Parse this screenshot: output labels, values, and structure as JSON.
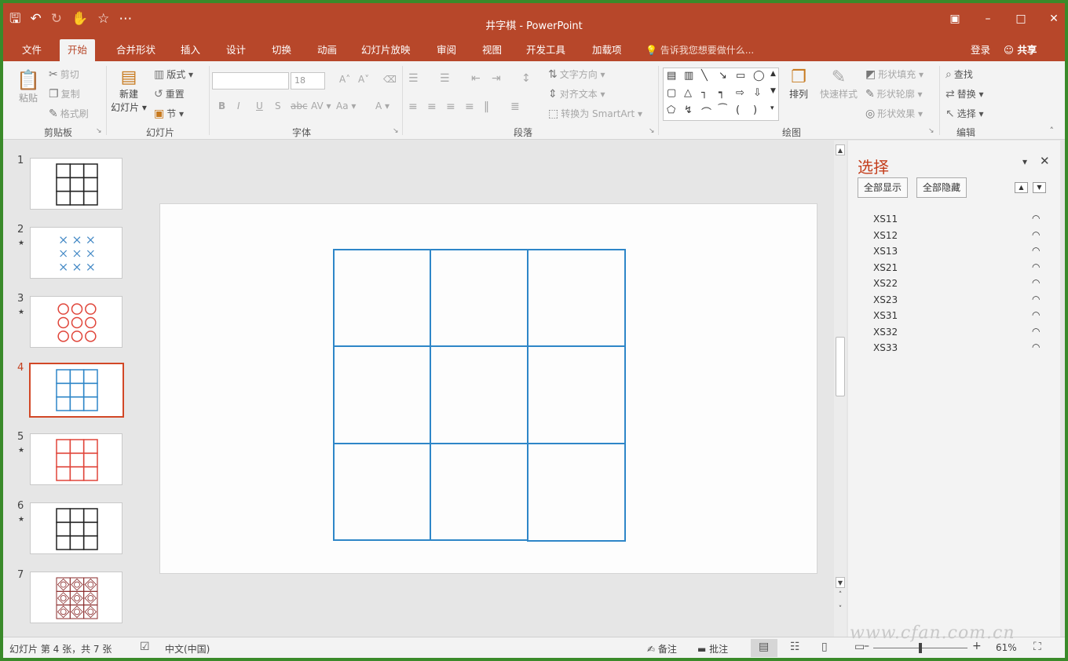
{
  "window": {
    "title": "井字棋 - PowerPoint",
    "qat": {
      "save_icon": "save-icon",
      "undo_icon": "undo-icon",
      "redo_icon": "redo-icon",
      "customize_glyph": "⋯"
    }
  },
  "tabs": {
    "items": [
      "文件",
      "开始",
      "合并形状",
      "插入",
      "设计",
      "切换",
      "动画",
      "幻灯片放映",
      "审阅",
      "视图",
      "开发工具",
      "加载项"
    ],
    "active": "开始",
    "tell_me": "告诉我您想要做什么...",
    "sign_in": "登录",
    "share": "共享"
  },
  "ribbon": {
    "clipboard": {
      "label": "剪贴板",
      "paste": "粘贴",
      "cut": "剪切",
      "copy": "复制",
      "format_painter": "格式刷"
    },
    "slides": {
      "label": "幻灯片",
      "new_slide_1": "新建",
      "new_slide_2": "幻灯片 ▾",
      "layout": "版式 ▾",
      "reset": "重置",
      "section": "节 ▾"
    },
    "font": {
      "label": "字体",
      "font_size": "18",
      "bold": "B",
      "italic": "I",
      "underline": "U",
      "shadow": "S",
      "strike": "abc",
      "spacing": "AV ▾",
      "case": "Aa ▾",
      "color": "A ▾",
      "grow": "A˄",
      "shrink": "A˅",
      "clear": "⌫"
    },
    "paragraph": {
      "label": "段落",
      "text_direction": "文字方向 ▾",
      "align_text": "对齐文本 ▾",
      "smartart": "转换为 SmartArt ▾"
    },
    "drawing": {
      "label": "绘图",
      "arrange": "排列",
      "quick_styles": "快速样式",
      "shape_fill": "形状填充 ▾",
      "shape_outline": "形状轮廓 ▾",
      "shape_effects": "形状效果 ▾"
    },
    "editing": {
      "label": "编辑",
      "find": "查找",
      "replace": "替换 ▾",
      "select": "选择 ▾"
    }
  },
  "slides": [
    {
      "number": "1",
      "has_star": false,
      "pattern": "grid",
      "color": "#222222"
    },
    {
      "number": "2",
      "has_star": true,
      "pattern": "crosses",
      "color": "#3f86c4"
    },
    {
      "number": "3",
      "has_star": true,
      "pattern": "circles",
      "color": "#e0453a"
    },
    {
      "number": "4",
      "has_star": false,
      "pattern": "grid",
      "color": "#2e86c8",
      "active": true
    },
    {
      "number": "5",
      "has_star": true,
      "pattern": "grid",
      "color": "#e0453a"
    },
    {
      "number": "6",
      "has_star": true,
      "pattern": "grid",
      "color": "#222222"
    },
    {
      "number": "7",
      "has_star": false,
      "pattern": "combo",
      "color": "#8a2a2a"
    }
  ],
  "slide_star_glyph": "★",
  "selection_pane": {
    "title": "选择",
    "show_all": "全部显示",
    "hide_all": "全部隐藏",
    "items": [
      "XS11",
      "XS12",
      "XS13",
      "XS21",
      "XS22",
      "XS23",
      "XS31",
      "XS32",
      "XS33"
    ],
    "eye_icon": "eye-icon"
  },
  "status": {
    "slide_info": "幻灯片 第 4 张，共 7 张",
    "language": "中文(中国)",
    "notes": "备注",
    "comments": "批注",
    "zoom": "61%",
    "zoom_level": 0.5
  },
  "colors": {
    "accent": "#b7472a",
    "grid_blue": "#2e86c8",
    "pane_title": "#c43e1c"
  },
  "watermark": "www.cfan.com.cn"
}
